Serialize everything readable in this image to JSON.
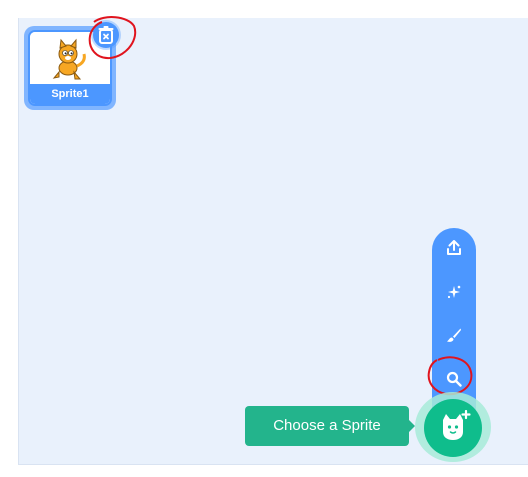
{
  "sprite_list": {
    "items": [
      {
        "name": "Sprite1",
        "selected": true
      }
    ]
  },
  "sprite_tile": {
    "delete_icon": "trash-icon"
  },
  "sprite_menu": {
    "items": [
      {
        "action": "upload",
        "icon": "upload-icon"
      },
      {
        "action": "surprise",
        "icon": "surprise-sparkle-icon"
      },
      {
        "action": "paint",
        "icon": "paintbrush-icon"
      },
      {
        "action": "choose",
        "icon": "search-icon"
      }
    ]
  },
  "choose_sprite": {
    "tooltip": "Choose a Sprite",
    "icon": "cat-plus-icon"
  },
  "colors": {
    "pane_background": "#e9f1fc",
    "accent_blue": "#4c97ff",
    "action_green": "#0fbd8c",
    "tooltip_green": "#23b48c",
    "annotation_red": "#e0141e"
  }
}
